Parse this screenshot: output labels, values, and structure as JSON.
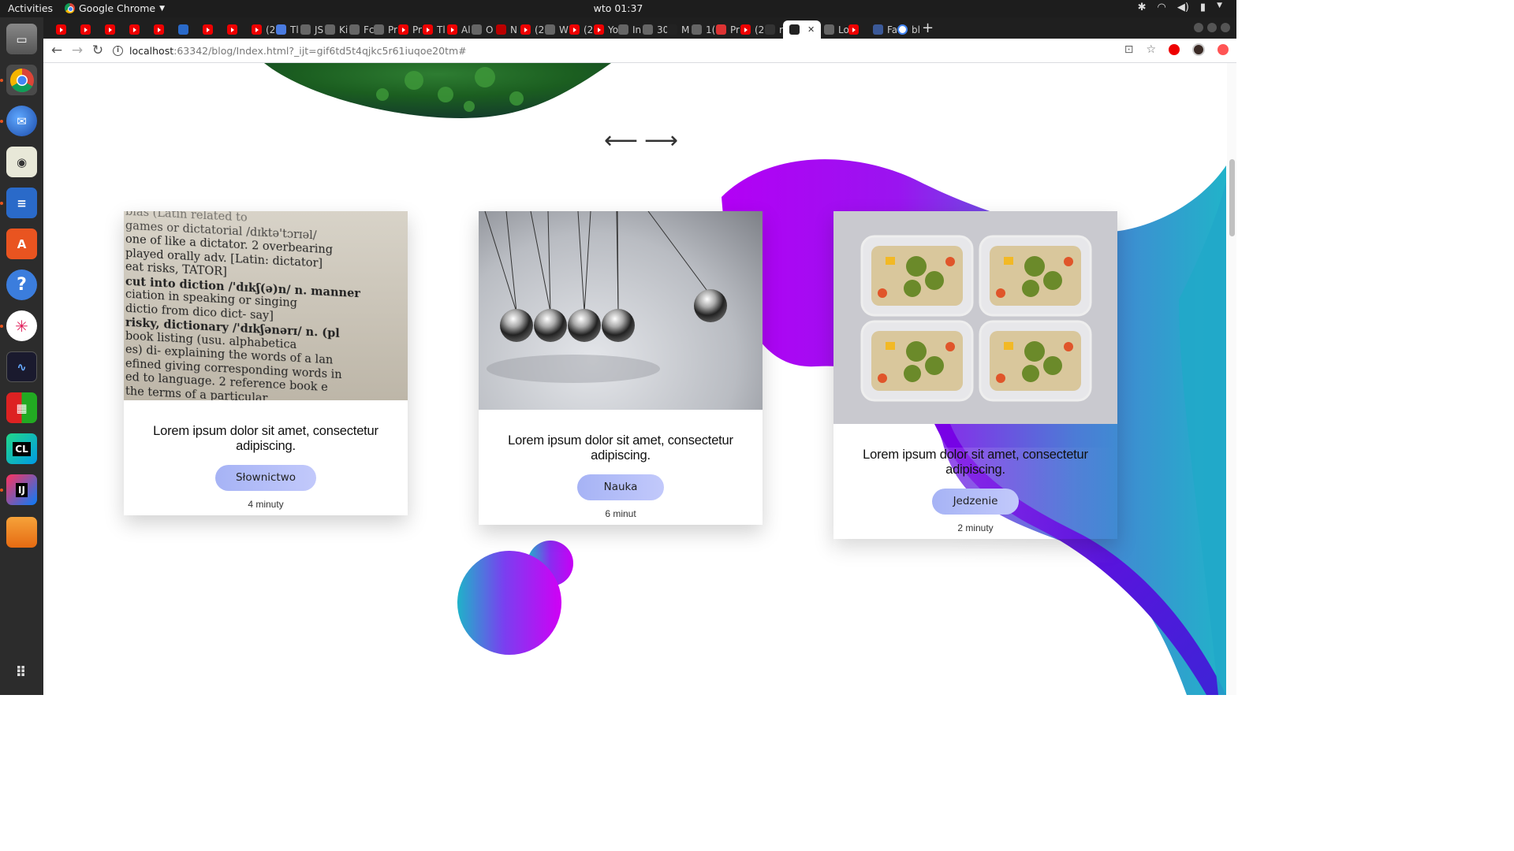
{
  "system": {
    "activities": "Activities",
    "app_name": "Google Chrome",
    "clock": "wto 01:37"
  },
  "tabs": [
    {
      "kind": "yt",
      "label": ""
    },
    {
      "kind": "yt",
      "label": ""
    },
    {
      "kind": "yt",
      "label": ""
    },
    {
      "kind": "yt",
      "label": ""
    },
    {
      "kind": "yt",
      "label": ""
    },
    {
      "kind": "sync",
      "label": ""
    },
    {
      "kind": "yt",
      "label": ""
    },
    {
      "kind": "yt",
      "label": ""
    },
    {
      "kind": "yt",
      "label": "(2"
    },
    {
      "kind": "tr",
      "label": "Tl"
    },
    {
      "kind": "misc",
      "label": "JS"
    },
    {
      "kind": "misc",
      "label": "Ki"
    },
    {
      "kind": "misc",
      "label": "Fc"
    },
    {
      "kind": "misc",
      "label": "Pr"
    },
    {
      "kind": "yt",
      "label": "Pr"
    },
    {
      "kind": "yt",
      "label": "Tl"
    },
    {
      "kind": "yt",
      "label": "Al"
    },
    {
      "kind": "misc",
      "label": "O"
    },
    {
      "kind": "nf",
      "label": "N"
    },
    {
      "kind": "yt",
      "label": "(2"
    },
    {
      "kind": "misc",
      "label": "W"
    },
    {
      "kind": "yt",
      "label": "(2"
    },
    {
      "kind": "yt",
      "label": "Yo"
    },
    {
      "kind": "misc",
      "label": "In"
    },
    {
      "kind": "misc",
      "label": "30"
    },
    {
      "kind": "ij",
      "label": "M"
    },
    {
      "kind": "misc",
      "label": "1("
    },
    {
      "kind": "gm",
      "label": "Pr"
    },
    {
      "kind": "yt",
      "label": "(2"
    },
    {
      "kind": "gh",
      "label": "ra"
    },
    {
      "kind": "ij-active",
      "label": ""
    },
    {
      "kind": "misc",
      "label": "Lo"
    },
    {
      "kind": "yt",
      "label": ""
    },
    {
      "kind": "fb",
      "label": "Fa"
    },
    {
      "kind": "g",
      "label": "bl"
    }
  ],
  "address_bar": {
    "host": "localhost",
    "path": ":63342/blog/Index.html?_ijt=gif6td5t4qjkc5r61iuqoe20tm#"
  },
  "slider": {
    "prev": "⟵",
    "next": "⟶"
  },
  "cards": [
    {
      "image": "dictionary-photo",
      "title": "Lorem ipsum dolor sit amet, consectetur adipiscing.",
      "tag": "Słownictwo",
      "time": "4 minuty"
    },
    {
      "image": "newtons-cradle-photo",
      "title": "Lorem ipsum dolor sit amet, consectetur adipiscing.",
      "tag": "Nauka",
      "time": "6 minut"
    },
    {
      "image": "meal-prep-photo",
      "title": "Lorem ipsum dolor sit amet, consectetur adipiscing.",
      "tag": "Jedzenie",
      "time": "2 minuty"
    }
  ],
  "colors": {
    "magenta": "#b100f5",
    "purple": "#6b1df0",
    "teal": "#1fb3c9",
    "pill": "#b4bdf8"
  },
  "dictionary_text": {
    "l1": "bias  (Latin related to",
    "l2": "games or  dictatorial /dɪktə'tɔrɪəl/",
    "l3": "one of   like a dictator. 2 overbearing",
    "l4": "played   orally adv. [Latin: dictator]",
    "l5": "eat risks,  TATOR]",
    "l6": "cut into  diction /'dɪkʃ(ə)n/ n. manner",
    "l7": "ciation in speaking or singing",
    "l8": "dictio from dico dict- say]",
    "l9": "risky,  dictionary /'dɪkʃənərɪ/ n. (pl",
    "l10": "book listing (usu. alphabetica",
    "l11": "es) di-  explaining the words of a lan",
    "l12": "efined  giving corresponding words in",
    "l13": "ed to  language. 2 reference book e",
    "l14": "the terms of a particular"
  }
}
